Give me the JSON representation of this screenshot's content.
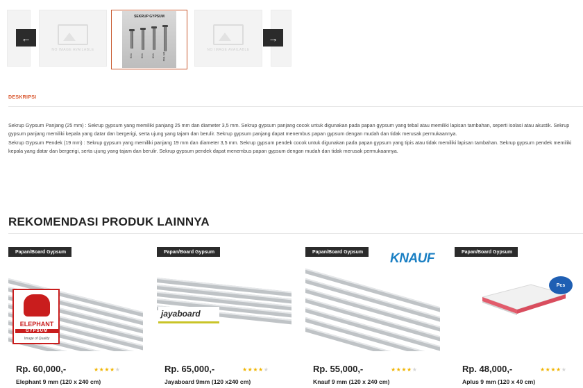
{
  "gallery": {
    "placeholder_text": "NO IMAGE AVAILABLE",
    "active_caption": "SEKRUP GYPSUM",
    "screw_labels": [
      "6X1",
      "6X1",
      "6X1",
      "6X1 1/2"
    ],
    "prev_icon": "←",
    "next_icon": "→"
  },
  "description": {
    "tab_label": "DESKRIPSI",
    "paragraphs": [
      "Sekrup Gypsum Panjang (25 mm) : Sekrup gypsum yang memiliki panjang 25 mm dan diameter 3,5 mm. Sekrup gypsum panjang cocok untuk digunakan pada papan gypsum yang tebal atau memiliki lapisan tambahan, seperti isolasi atau akustik. Sekrup gypsum panjang memiliki kepala yang datar dan bergerigi, serta ujung yang tajam dan berulir. Sekrup gypsum panjang dapat menembus papan gypsum dengan mudah dan tidak merusak permukaannya.",
      "Sekrup Gypsum Pendek (19 mm) : Sekrup gypsum yang memiliki panjang 19 mm dan diameter 3,5 mm. Sekrup gypsum pendek cocok untuk digunakan pada papan gypsum yang tipis atau tidak memiliki lapisan tambahan. Sekrup gypsum pendek memiliki kepala yang datar dan bergerigi, serta ujung yang tajam dan berulir. Sekrup gypsum pendek dapat menembus papan gypsum dengan mudah dan tidak merusak permukaannya."
    ]
  },
  "recommendations": {
    "title": "REKOMENDASI PRODUK LAINNYA",
    "star_icon": "★",
    "products": [
      {
        "category": "Papan/Board Gypsum",
        "price": "Rp. 60,000,-",
        "name": "Elephant 9 mm (120 x 240 cm)",
        "rating": 4,
        "logo_title": "ELEPHANT",
        "logo_sub": "GYPSUM",
        "logo_tag": "Image of Quality"
      },
      {
        "category": "Papan/Board Gypsum",
        "price": "Rp. 65,000,-",
        "name": "Jayaboard 9mm (120 x240 cm)",
        "rating": 4,
        "logo_title": "jayaboard"
      },
      {
        "category": "Papan/Board Gypsum",
        "price": "Rp. 55,000,-",
        "name": "Knauf 9 mm (120 x 240 cm)",
        "rating": 4,
        "logo_title": "KNAUF"
      },
      {
        "category": "Papan/Board Gypsum",
        "price": "Rp. 48,000,-",
        "name": "Aplus 9 mm (120 x 40 cm)",
        "rating": 4,
        "badge": "Pcs"
      }
    ]
  },
  "colors": {
    "accent": "#d9542b",
    "dark_badge": "#2b2b2b",
    "star_on": "#f0b400",
    "star_off": "#d4d4d4",
    "knauf_blue": "#1a7fc3",
    "elephant_red": "#c91d1d"
  }
}
